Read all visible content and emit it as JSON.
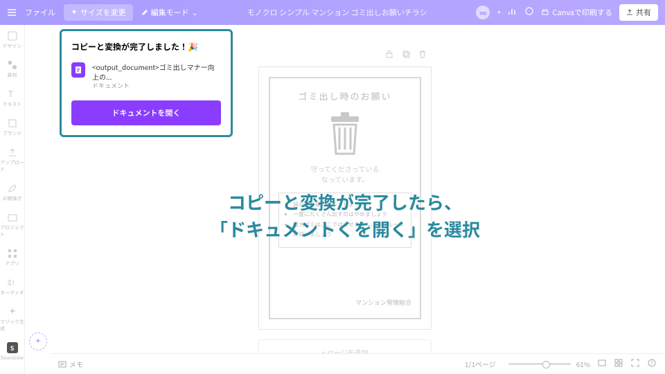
{
  "topbar": {
    "file": "ファイル",
    "resize": "サイズを変更",
    "edit_mode": "編集モード",
    "doc_title": "モノクロ シンプル マンション ゴミ出しお願いチラシ",
    "print": "Canvaで印刷する",
    "share": "共有"
  },
  "sidebar": {
    "items": [
      {
        "label": "デザイン"
      },
      {
        "label": "素材"
      },
      {
        "label": "テキスト"
      },
      {
        "label": "ブランド"
      },
      {
        "label": "アップロード"
      },
      {
        "label": "お絵描き"
      },
      {
        "label": "プロジェクト"
      },
      {
        "label": "アプリ"
      },
      {
        "label": "オーディオ"
      },
      {
        "label": "マジック生成"
      },
      {
        "label": "Soundraw"
      }
    ]
  },
  "toast": {
    "title": "コピーと変換が完了しました！🎉",
    "doc_name": "<output_document>ゴミ出しマナー向上の...",
    "doc_type": "ドキュメント",
    "button": "ドキュメントを開く"
  },
  "overlay": {
    "line1": "コピーと変換が完了したら、",
    "line2": "「ドキュメントくを開く」を選択"
  },
  "document": {
    "heading": "ゴミ出し時のお願い",
    "subtext1": "守ってくださっている",
    "subtext2": "なっています。",
    "rules": [
      "袋の口は硬く縛りましょう",
      "一度にたくさん出すのはやめましょう",
      "粗大ゴミはここでは出せません。市のルールに従いましょう"
    ],
    "footer": "マンション管理組合",
    "add_page": "+ ページを追加"
  },
  "bottombar": {
    "notes": "メモ",
    "page": "1/1ページ",
    "zoom": "61%"
  }
}
